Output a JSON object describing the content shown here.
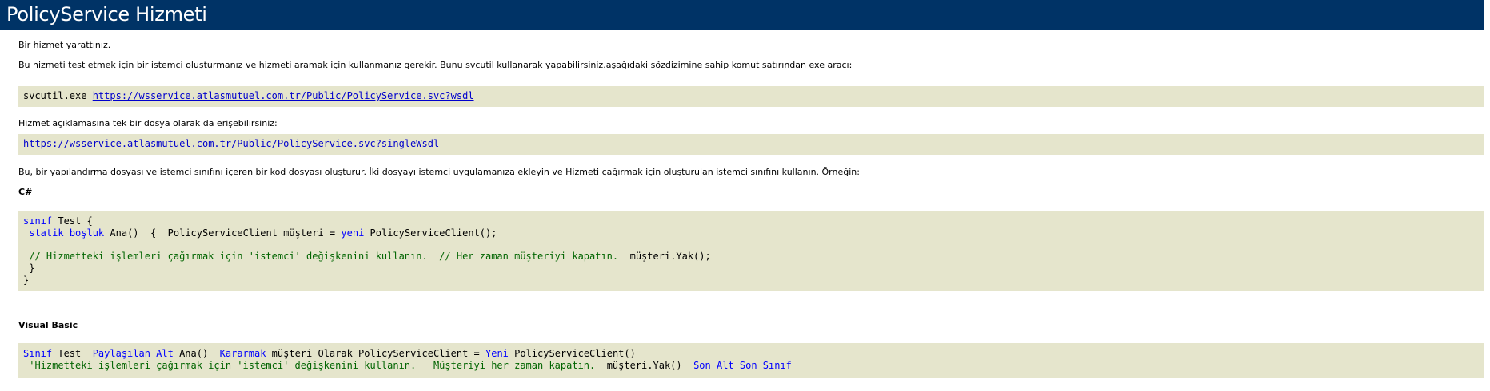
{
  "page": {
    "title": "PolicyService Hizmeti"
  },
  "intro": {
    "created": "Bir hizmet yarattınız.",
    "test_info": "Bu hizmeti test etmek için bir istemci oluşturmanız ve hizmeti aramak için kullanmanız gerekir. Bunu svcutil kullanarak yapabilirsiniz.aşağıdaki sözdizimine sahip komut satırından exe aracı:"
  },
  "svcutil": {
    "command": "svcutil.exe ",
    "wsdl_url": "https://wsservice.atlasmutuel.com.tr/Public/PolicyService.svc?wsdl"
  },
  "single_file": {
    "label": "Hizmet açıklamasına tek bir dosya olarak da erişebilirsiniz:",
    "url": "https://wsservice.atlasmutuel.com.tr/Public/PolicyService.svc?singleWsdl"
  },
  "config_info": "Bu, bir yapılandırma dosyası ve istemci sınıfını içeren bir kod dosyası oluşturur. İki dosyayı istemci uygulamanıza ekleyin ve Hizmeti çağırmak için oluşturulan istemci sınıfını kullanın. Örneğin:",
  "csharp": {
    "heading": "C#",
    "l1_kw": "sınıf",
    "l1_rest": " Test {",
    "l2_kw1": " statik",
    "l2_sp": " ",
    "l2_kw2": "boşluk",
    "l2_rest": " Ana()  {  PolicyServiceClient müşteri = ",
    "l2_kw3": "yeni",
    "l2_end": " PolicyServiceClient();",
    "l3_comment": " // Hizmetteki işlemleri çağırmak için 'istemci' değişkenini kullanın.  // Her zaman müşteriyi kapatın.",
    "l3_rest": "  müşteri.Yak();",
    "l4": " }",
    "l5": "}"
  },
  "vb": {
    "heading": "Visual Basic",
    "l1_kw1": "Sınıf",
    "l1_a": " Test  ",
    "l1_kw2": "Paylaşılan Alt",
    "l1_b": " Ana()  ",
    "l1_kw3": "Kararmak",
    "l1_c": " müşteri Olarak PolicyServiceClient = ",
    "l1_kw4": "Yeni",
    "l1_d": " PolicyServiceClient()",
    "l2_comment": " 'Hizmetteki işlemleri çağırmak için 'istemci' değişkenini kullanın.   Müşteriyi her zaman kapatın.",
    "l2_rest": "  müşteri.Yak()  ",
    "l2_kw": "Son Alt Son Sınıf"
  },
  "colors": {
    "header_bg": "#003366",
    "code_bg": "#e5e5cc",
    "keyword": "#0000ff",
    "comment": "#006400",
    "link": "#0000cc"
  }
}
